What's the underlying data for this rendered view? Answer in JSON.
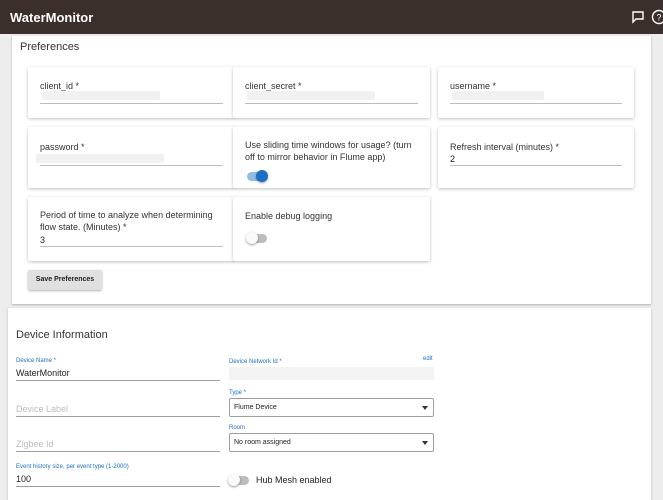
{
  "appbar": {
    "title": "WaterMonitor"
  },
  "preferences": {
    "section_title": "Preferences",
    "fields": {
      "client_id": {
        "label": "client_id *"
      },
      "client_secret": {
        "label": "client_secret *"
      },
      "username": {
        "label": "username *"
      },
      "password": {
        "label": "password *"
      },
      "sliding": {
        "label": "Use sliding time windows for usage? (turn off to mirror behavior in Flume app)",
        "on": true
      },
      "refresh": {
        "label": "Refresh interval (minutes) *",
        "value": "2"
      },
      "period": {
        "label": "Period of time to analyze when determining flow state. (Minutes) *",
        "value": "3"
      },
      "debug": {
        "label": "Enable debug logging",
        "on": false
      }
    },
    "save_label": "Save Preferences"
  },
  "device": {
    "section_title": "Device Information",
    "name": {
      "label": "Device Name *",
      "value": "WaterMonitor"
    },
    "network_id": {
      "label": "Device Network Id *",
      "edit_label": "edit"
    },
    "device_label": {
      "placeholder": "Device Label"
    },
    "type": {
      "label": "Type *",
      "value": "Flume Device"
    },
    "zigbee": {
      "placeholder": "Zigbee Id"
    },
    "room": {
      "label": "Room",
      "value": "No room assigned"
    },
    "event_history": {
      "label": "Event history size, per event type (1-2000)",
      "value": "100"
    },
    "hub_mesh": {
      "label": "Hub Mesh enabled",
      "on": false
    }
  },
  "colors": {
    "appbar": "#3b2f2b",
    "accent": "#1e6fc2",
    "toggle_on": "#1e6fc2"
  },
  "icons": {
    "chat": "chat-icon",
    "help": "help-icon"
  }
}
